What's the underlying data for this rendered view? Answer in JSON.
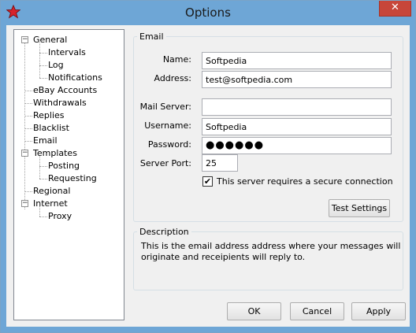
{
  "window": {
    "title": "Options",
    "close_glyph": "✕"
  },
  "tree": {
    "expander_glyph": "−",
    "items": [
      {
        "label": "General"
      },
      {
        "label": "Intervals"
      },
      {
        "label": "Log"
      },
      {
        "label": "Notifications"
      },
      {
        "label": "eBay Accounts"
      },
      {
        "label": "Withdrawals"
      },
      {
        "label": "Replies"
      },
      {
        "label": "Blacklist"
      },
      {
        "label": "Email"
      },
      {
        "label": "Templates"
      },
      {
        "label": "Posting"
      },
      {
        "label": "Requesting"
      },
      {
        "label": "Regional"
      },
      {
        "label": "Internet"
      },
      {
        "label": "Proxy"
      }
    ]
  },
  "email": {
    "group_title": "Email",
    "name_label": "Name:",
    "name_value": "Softpedia",
    "address_label": "Address:",
    "address_value": "test@softpedia.com",
    "mail_server_label": "Mail Server:",
    "mail_server_value": "",
    "username_label": "Username:",
    "username_value": "Softpedia",
    "password_label": "Password:",
    "password_value": "●●●●●●",
    "port_label": "Server Port:",
    "port_value": "25",
    "secure_label": "This server requires a secure connection",
    "secure_checked": "✔",
    "test_button": "Test Settings"
  },
  "description": {
    "group_title": "Description",
    "line1": "This is the email address address where your messages will",
    "line2": "originate and receipients will reply to."
  },
  "footer": {
    "ok": "OK",
    "cancel": "Cancel",
    "apply": "Apply"
  },
  "colors": {
    "titlebar": "#6ea6d6",
    "close": "#c7463a",
    "dialog": "#f0f0f0"
  }
}
